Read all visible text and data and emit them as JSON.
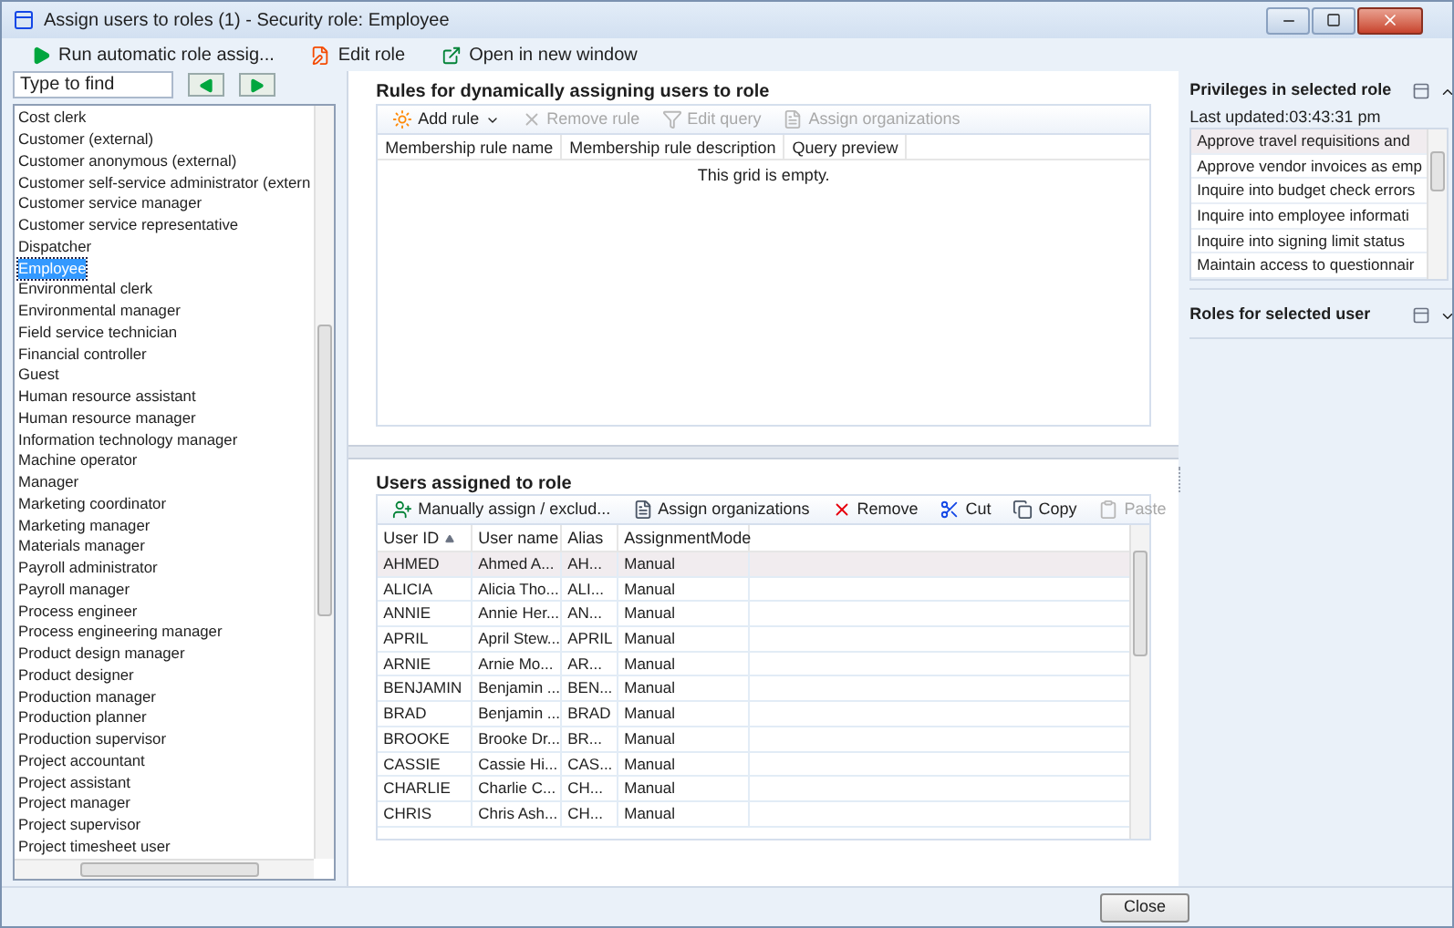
{
  "window": {
    "title": "Assign users to roles (1) - Security role: Employee"
  },
  "toolbar": [
    {
      "label": "Run automatic role assig..."
    },
    {
      "label": "Edit role"
    },
    {
      "label": "Open in new window"
    }
  ],
  "role_search": {
    "placeholder": "Type to find"
  },
  "roles": [
    {
      "label": "Cost clerk",
      "selected": false
    },
    {
      "label": "Customer (external)",
      "selected": false
    },
    {
      "label": "Customer anonymous (external)",
      "selected": false
    },
    {
      "label": "Customer self-service administrator (extern",
      "selected": false
    },
    {
      "label": "Customer service manager",
      "selected": false
    },
    {
      "label": "Customer service representative",
      "selected": false
    },
    {
      "label": "Dispatcher",
      "selected": false
    },
    {
      "label": "Employee",
      "selected": true
    },
    {
      "label": "Environmental clerk",
      "selected": false
    },
    {
      "label": "Environmental manager",
      "selected": false
    },
    {
      "label": "Field service technician",
      "selected": false
    },
    {
      "label": "Financial controller",
      "selected": false
    },
    {
      "label": "Guest",
      "selected": false
    },
    {
      "label": "Human resource assistant",
      "selected": false
    },
    {
      "label": "Human resource manager",
      "selected": false
    },
    {
      "label": "Information technology manager",
      "selected": false
    },
    {
      "label": "Machine operator",
      "selected": false
    },
    {
      "label": "Manager",
      "selected": false
    },
    {
      "label": "Marketing coordinator",
      "selected": false
    },
    {
      "label": "Marketing manager",
      "selected": false
    },
    {
      "label": "Materials manager",
      "selected": false
    },
    {
      "label": "Payroll administrator",
      "selected": false
    },
    {
      "label": "Payroll manager",
      "selected": false
    },
    {
      "label": "Process engineer",
      "selected": false
    },
    {
      "label": "Process engineering manager",
      "selected": false
    },
    {
      "label": "Product design manager",
      "selected": false
    },
    {
      "label": "Product designer",
      "selected": false
    },
    {
      "label": "Production manager",
      "selected": false
    },
    {
      "label": "Production planner",
      "selected": false
    },
    {
      "label": "Production supervisor",
      "selected": false
    },
    {
      "label": "Project accountant",
      "selected": false
    },
    {
      "label": "Project assistant",
      "selected": false
    },
    {
      "label": "Project manager",
      "selected": false
    },
    {
      "label": "Project supervisor",
      "selected": false
    },
    {
      "label": "Project timesheet user",
      "selected": false
    }
  ],
  "rules": {
    "title": "Rules for dynamically assigning users to role",
    "toolbar": [
      {
        "label": "Add rule",
        "disabled": false
      },
      {
        "label": "Remove rule",
        "disabled": true
      },
      {
        "label": "Edit query",
        "disabled": true
      },
      {
        "label": "Assign organizations",
        "disabled": true
      }
    ],
    "columns": [
      "Membership rule name",
      "Membership rule description",
      "Query preview"
    ],
    "empty_message": "This grid is empty."
  },
  "users": {
    "title": "Users assigned to role",
    "toolbar": [
      {
        "label": "Manually assign / exclud...",
        "disabled": false
      },
      {
        "label": "Assign organizations",
        "disabled": false
      },
      {
        "label": "Remove",
        "disabled": false
      },
      {
        "label": "Cut",
        "disabled": false
      },
      {
        "label": "Copy",
        "disabled": false
      },
      {
        "label": "Paste",
        "disabled": true
      }
    ],
    "columns": [
      "User ID",
      "User name",
      "Alias",
      "AssignmentMode"
    ],
    "rows": [
      {
        "cells": [
          "AHMED",
          "Ahmed A...",
          "AH...",
          "Manual"
        ],
        "selected": true
      },
      {
        "cells": [
          "ALICIA",
          "Alicia Tho...",
          "ALI...",
          "Manual"
        ],
        "selected": false
      },
      {
        "cells": [
          "ANNIE",
          "Annie Her...",
          "AN...",
          "Manual"
        ],
        "selected": false
      },
      {
        "cells": [
          "APRIL",
          "April Stew...",
          "APRIL",
          "Manual"
        ],
        "selected": false
      },
      {
        "cells": [
          "ARNIE",
          "Arnie Mo...",
          "AR...",
          "Manual"
        ],
        "selected": false
      },
      {
        "cells": [
          "BENJAMIN",
          "Benjamin ...",
          "BEN...",
          "Manual"
        ],
        "selected": false
      },
      {
        "cells": [
          "BRAD",
          "Benjamin ...",
          "BRAD",
          "Manual"
        ],
        "selected": false
      },
      {
        "cells": [
          "BROOKE",
          "Brooke Dr...",
          "BR...",
          "Manual"
        ],
        "selected": false
      },
      {
        "cells": [
          "CASSIE",
          "Cassie Hi...",
          "CAS...",
          "Manual"
        ],
        "selected": false
      },
      {
        "cells": [
          "CHARLIE",
          "Charlie C...",
          "CH...",
          "Manual"
        ],
        "selected": false
      },
      {
        "cells": [
          "CHRIS",
          "Chris Ash...",
          "CH...",
          "Manual"
        ],
        "selected": false
      }
    ]
  },
  "side_panels": [
    {
      "title": "Privileges in selected role",
      "expanded": true,
      "last_updated": "Last updated:03:43:31 pm",
      "items": [
        {
          "label": "Approve travel requisitions and",
          "selected": true
        },
        {
          "label": "Approve vendor invoices as emp",
          "selected": false
        },
        {
          "label": "Inquire into budget check errors",
          "selected": false
        },
        {
          "label": "Inquire into employee informati",
          "selected": false
        },
        {
          "label": "Inquire into signing limit status",
          "selected": false
        },
        {
          "label": "Maintain access to questionnair",
          "selected": false
        }
      ]
    },
    {
      "title": "Roles for selected user",
      "expanded": false
    }
  ],
  "footer": {
    "close_button": "Close"
  }
}
